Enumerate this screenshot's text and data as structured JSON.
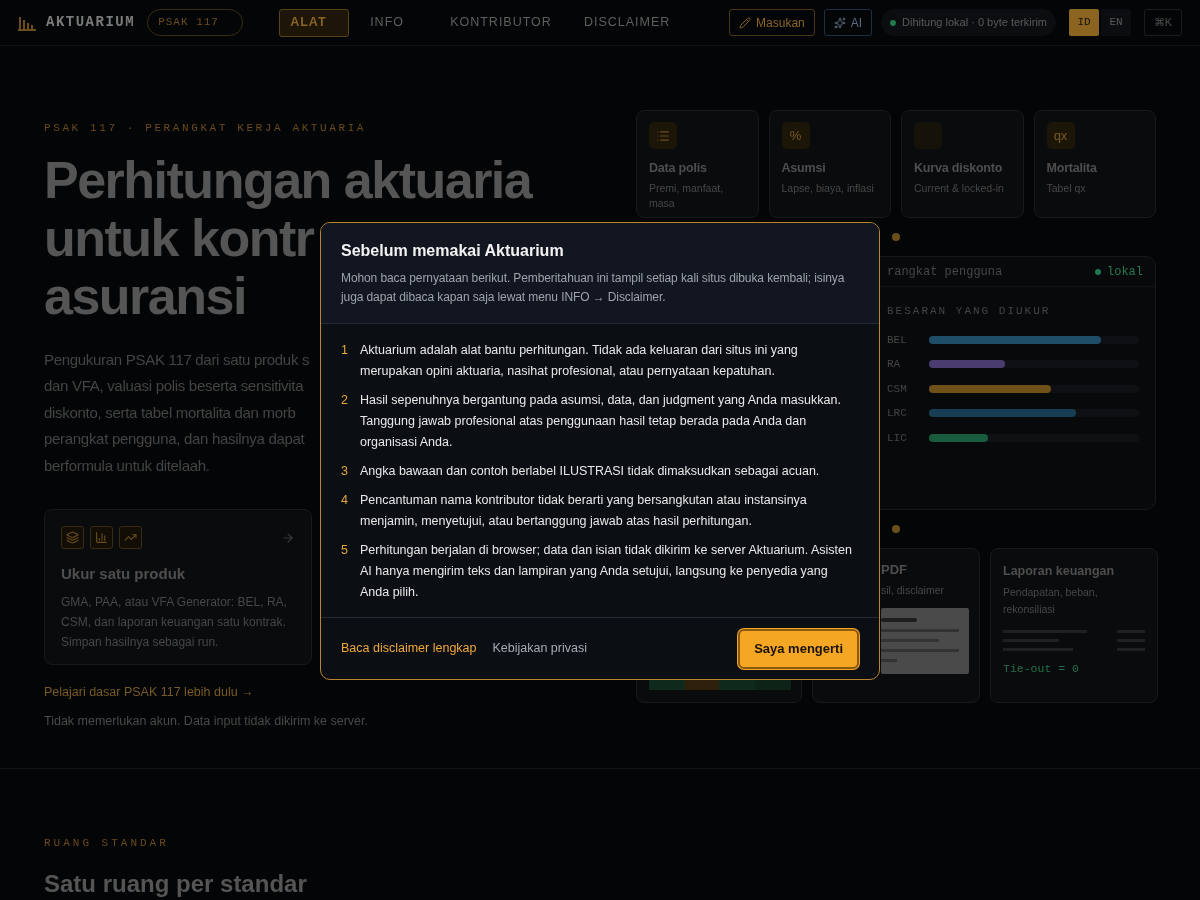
{
  "header": {
    "brand": "AKTUARIUM",
    "badge": "PSAK 117",
    "tabs": [
      {
        "label": "ALAT",
        "selected": true
      },
      {
        "label": "INFO",
        "selected": false
      },
      {
        "label": "KONTRIBUTOR",
        "selected": false
      },
      {
        "label": "DISCLAIMER",
        "selected": false
      }
    ],
    "feedback_button": "Masukan",
    "ai_button": "AI",
    "status": "Dihitung lokal · 0 byte terkirim",
    "languages": [
      {
        "label": "ID",
        "selected": true
      },
      {
        "label": "EN",
        "selected": false
      }
    ],
    "shortcut": "⌘K"
  },
  "hero": {
    "kicker": "PSAK 117 · PERANGKAT KERJA AKTUARIA",
    "title_lines": [
      "Perhitungan aktuaria",
      "untuk kontr",
      "asuransi"
    ],
    "paragraph_lines": [
      "Pengukuran PSAK 117 dari satu produk s",
      "dan VFA, valuasi polis beserta sensitivita",
      "diskonto, serta tabel mortalita dan morb",
      "perangkat pengguna, dan hasilnya dapat",
      "berformula untuk ditelaah."
    ],
    "card": {
      "title": "Ukur satu produk",
      "text": "GMA, PAA, atau VFA Generator: BEL, RA, CSM, dan laporan keuangan satu kontrak. Simpan hasilnya sebagai run."
    },
    "link": "Pelajari dasar PSAK 117 lebih dulu →",
    "note": "Tidak memerlukan akun. Data input tidak dikirim ke server."
  },
  "inputs": [
    {
      "kind": "table",
      "title": "Data polis",
      "subtitle": "Premi, manfaat, masa"
    },
    {
      "kind": "glyph",
      "glyph": "%",
      "title": "Asumsi",
      "subtitle": "Lapse, biaya, inflasi"
    },
    {
      "kind": "blank",
      "title": "Kurva diskonto",
      "subtitle": "Current & locked-in"
    },
    {
      "kind": "glyph",
      "glyph": "qx",
      "title": "Mortalita",
      "subtitle": "Tabel qx"
    }
  ],
  "dashboard": {
    "header": "rangkat pengguna",
    "status": "lokal",
    "heading": "BESARAN YANG DIUKUR",
    "measures": [
      {
        "label": "BEL",
        "level": 0.82,
        "color": "#1f4f68"
      },
      {
        "label": "RA",
        "level": 0.36,
        "color": "#4b3c70"
      },
      {
        "label": "CSM",
        "level": 0.58,
        "color": "#6e5018"
      },
      {
        "label": "LRC",
        "level": 0.7,
        "color": "#183e55"
      },
      {
        "label": "LIC",
        "level": 0.28,
        "color": "#175c3c"
      }
    ]
  },
  "outputs": [
    {
      "kind": "strip"
    },
    {
      "kind": "pdf",
      "title": "PDF",
      "subtitle": "sil, disclaimer"
    },
    {
      "kind": "report",
      "title": "Laporan keuangan",
      "subtitle": "Pendapatan, beban, rekonsiliasi",
      "code": "Tie-out = 0"
    }
  ],
  "section": {
    "kicker": "RUANG STANDAR",
    "title": "Satu ruang per standar"
  },
  "modal": {
    "title": "Sebelum memakai Aktuarium",
    "intro": "Mohon baca pernyataan berikut. Pemberitahuan ini tampil setiap kali situs dibuka kembali; isinya juga dapat dibaca kapan saja lewat menu INFO → Disclaimer.",
    "items": [
      {
        "number": "1",
        "text": "Aktuarium adalah alat bantu perhitungan. Tidak ada keluaran dari situs ini yang merupakan opini aktuaria, nasihat profesional, atau pernyataan kepatuhan."
      },
      {
        "number": "2",
        "text": "Hasil sepenuhnya bergantung pada asumsi, data, dan judgment yang Anda masukkan. Tanggung jawab profesional atas penggunaan hasil tetap berada pada Anda dan organisasi Anda."
      },
      {
        "number": "3",
        "text": "Angka bawaan dan contoh berlabel ILUSTRASI tidak dimaksudkan sebagai acuan."
      },
      {
        "number": "4",
        "text": "Pencantuman nama kontributor tidak berarti yang bersangkutan atau instansinya menjamin, menyetujui, atau bertanggung jawab atas hasil perhitungan."
      },
      {
        "number": "5",
        "text": "Perhitungan berjalan di browser; data dan isian tidak dikirim ke server Aktuarium. Asisten AI hanya mengirim teks dan lampiran yang Anda setujui, langsung ke penyedia yang Anda pilih."
      }
    ],
    "links": [
      "Baca disclaimer lengkap",
      "Kebijakan privasi"
    ],
    "confirm": "Saya mengerti"
  }
}
